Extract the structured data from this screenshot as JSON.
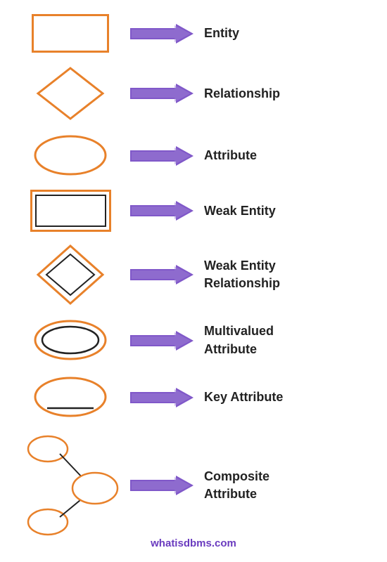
{
  "symbols": [
    {
      "id": "entity",
      "label": "Entity"
    },
    {
      "id": "relationship",
      "label": "Relationship"
    },
    {
      "id": "attribute",
      "label": "Attribute"
    },
    {
      "id": "weak-entity",
      "label": "Weak  Entity"
    },
    {
      "id": "weak-entity-relationship",
      "label": "Weak  Entity\nRelationship"
    },
    {
      "id": "multivalued-attribute",
      "label": "Multivalued\nAttribute"
    },
    {
      "id": "key-attribute",
      "label": "Key  Attribute"
    }
  ],
  "composite": {
    "label": "Composite\nAttribute"
  },
  "watermark": "whatisdbms.com",
  "colors": {
    "orange": "#e8812a",
    "purple": "#6a3bbf",
    "black": "#222222",
    "white": "#ffffff"
  }
}
